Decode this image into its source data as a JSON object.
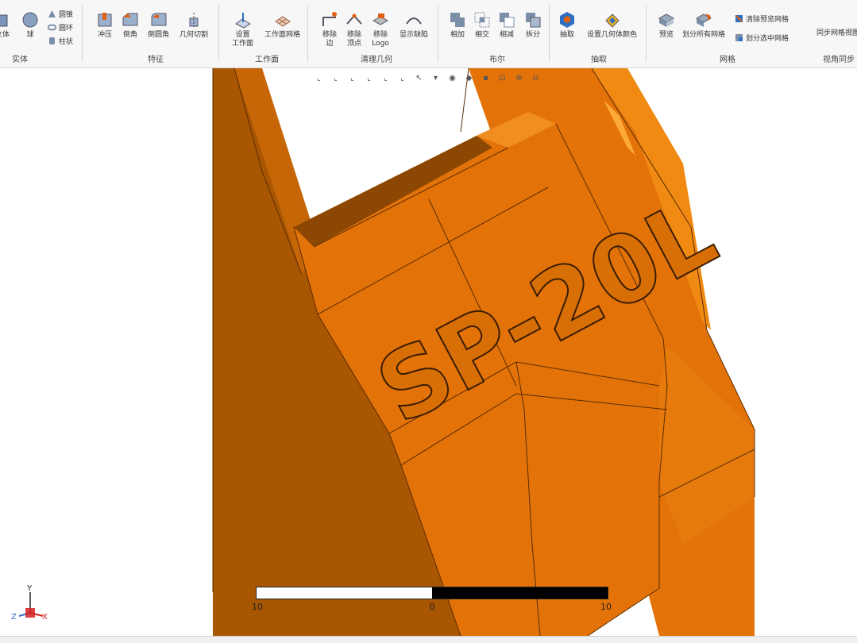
{
  "ribbon": {
    "solid": {
      "label": "实体",
      "box_label": "立体",
      "sphere_label": "球",
      "cone_label": "圆锥",
      "ring_label": "圆环",
      "cylinder_label": "柱状"
    },
    "feature": {
      "label": "特征",
      "extrude_label": "冲压",
      "chamfer_label": "倒角",
      "fillet_label": "倒圆角",
      "cut_label": "几何切割"
    },
    "workplane": {
      "label": "工作面",
      "set_label_1": "设置",
      "set_label_2": "工作面",
      "grid_label": "工作面网格"
    },
    "cleanup": {
      "label": "清理几何",
      "edge_label_1": "移除",
      "edge_label_2": "边",
      "vertex_label_1": "移除",
      "vertex_label_2": "顶点",
      "logo_label_1": "移除",
      "logo_label_2": "Logo",
      "defects_label": "显示缺陷"
    },
    "boolean": {
      "label": "布尔",
      "add_label": "相加",
      "intersect_label": "相交",
      "subtract_label": "相减",
      "split_label": "拆分"
    },
    "extract": {
      "label": "抽取",
      "extract_label": "抽取",
      "color_label": "设置几何体颜色"
    },
    "mesh": {
      "label": "网格",
      "preview_label": "预览",
      "mesh_all_label": "划分所有网格",
      "clear_label": "清除预览网格",
      "mesh_selected_label": "划分选中网格"
    },
    "viewsync": {
      "label": "视角同步",
      "sync_label": "同步网格视图"
    }
  },
  "viewport": {
    "model_text": "SP-20L",
    "scale": {
      "left": "10",
      "mid": "0",
      "right": "10"
    },
    "triad": {
      "y": "Y",
      "z": "Z",
      "x": "X"
    }
  },
  "colors": {
    "model_main": "#e37308",
    "model_dark": "#a95603",
    "accent": "#2e6fc4"
  }
}
